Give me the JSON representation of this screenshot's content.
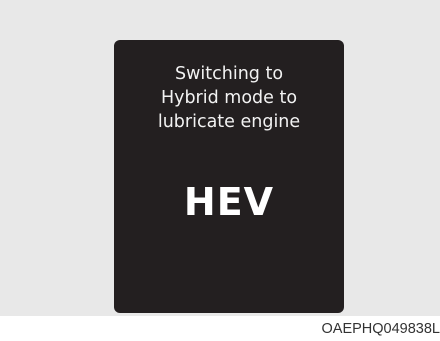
{
  "display": {
    "message_lines": [
      "Switching to",
      "Hybrid mode to",
      "lubricate engine"
    ],
    "mode_label": "HEV"
  },
  "figure_code": "OAEPHQ049838L",
  "colors": {
    "panel_background": "#e8e8e8",
    "display_background": "#231f20",
    "display_text": "#f2f2f2"
  }
}
